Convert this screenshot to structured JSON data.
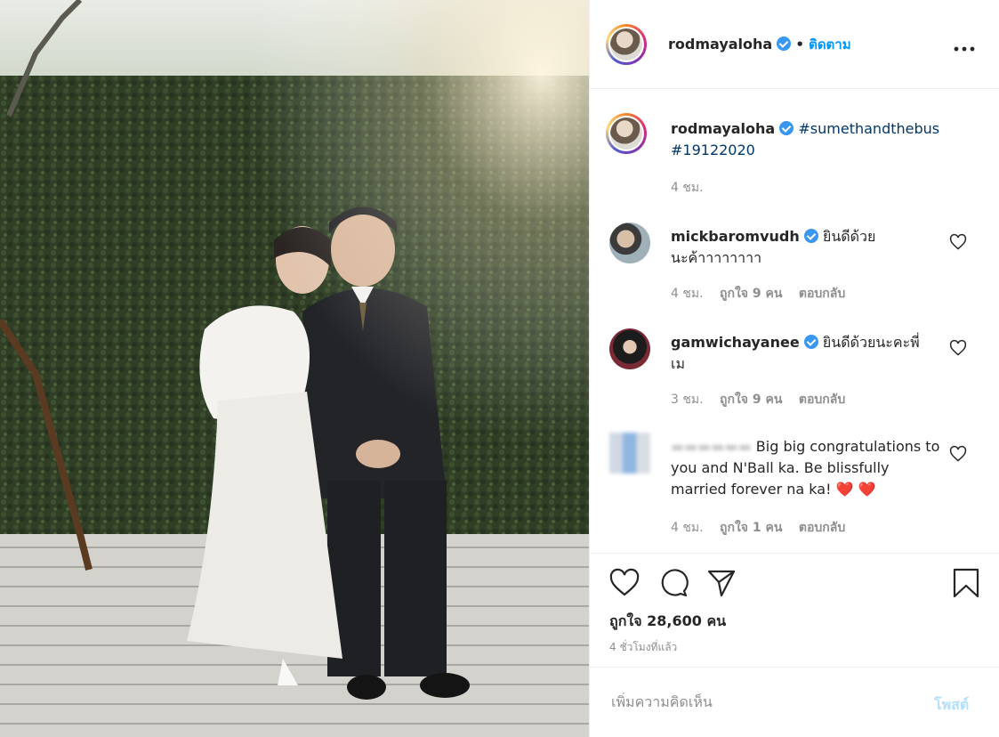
{
  "header": {
    "username": "rodmayaloha",
    "dot": "•",
    "follow_label": "ติดตาม",
    "more_icon": "more-horizontal-icon"
  },
  "caption": {
    "username": "rodmayaloha",
    "hashtag1": "#sumethandthebus",
    "hashtag2": "#19122020",
    "time": "4 ชม."
  },
  "comments": [
    {
      "username": "mickbaromvudh",
      "text_line1": "ยินดีด้วย",
      "text_line2": "นะค้าาาาาาาา",
      "time": "4 ชม.",
      "likes": "ถูกใจ 9 คน",
      "reply": "ตอบกลับ"
    },
    {
      "username": "gamwichayanee",
      "text_line1": "ยินดีด้วยนะคะพี่",
      "text_line2": "เม",
      "time": "3 ชม.",
      "likes": "ถูกใจ 9 คน",
      "reply": "ตอบกลับ"
    },
    {
      "username": "",
      "text": "Big big congratulations to you and N'Ball ka. Be blissfully married forever na ka! ❤️ ❤️",
      "time": "4 ชม.",
      "likes": "ถูกใจ 1 คน",
      "reply": "ตอบกลับ"
    }
  ],
  "actions": {
    "likes_count": "ถูกใจ 28,600 คน",
    "ago": "4 ชั่วโมงที่แล้ว"
  },
  "add_comment": {
    "placeholder": "เพิ่มความคิดเห็น",
    "post_label": "โพสต์"
  },
  "colors": {
    "accent": "#0095f6",
    "verified": "#3897f0",
    "hashtag": "#00376b",
    "muted": "#8e8e8e"
  }
}
